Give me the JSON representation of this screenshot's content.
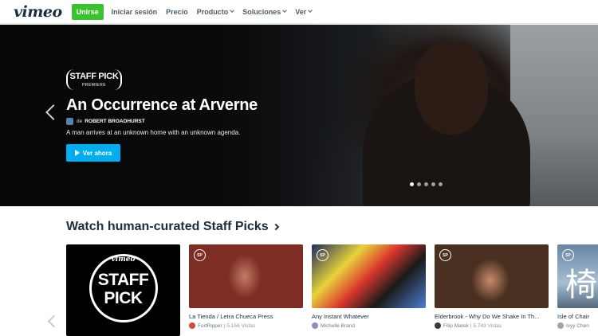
{
  "nav": {
    "logo": "vimeo",
    "join": "Unirse",
    "login": "Iniciar sesión",
    "price": "Precio",
    "product": "Producto",
    "solutions": "Soluciones",
    "watch": "Ver"
  },
  "hero": {
    "badge_main": "STAFF PICK",
    "badge_sub": "PREMIERE",
    "title": "An Occurrence at Arverne",
    "by": "de",
    "author": "ROBERT BROADHURST",
    "description": "A man arrives at an unknown home with an unknown agenda.",
    "watch_button": "Ver ahora",
    "slide_count": 5,
    "active_slide": 1
  },
  "section": {
    "title": "Watch human-curated Staff Picks"
  },
  "staff_pick_card": {
    "brand": "vimeo",
    "line1": "STAFF",
    "line2": "PICK"
  },
  "videos": [
    {
      "tag": "SP",
      "title": "La Tienda / Letra Chueca Press",
      "author": "FortRipper",
      "views": "5.156 Vistas",
      "avatar_color": "#d24a3a"
    },
    {
      "tag": "SP",
      "title": "Any Instant Whatever",
      "author": "Michelle Brand",
      "views": "",
      "avatar_color": "#8a8fc0"
    },
    {
      "tag": "SP",
      "title": "Elderbrook - Why Do We Shake In Th...",
      "author": "Filip Marek",
      "views": "5.743 Vistas",
      "avatar_color": "#333a40"
    },
    {
      "tag": "SP",
      "title": "Isle of Chair",
      "author": "Ivyy Chen",
      "views": "",
      "avatar_color": "#9aa4ac",
      "glyph": "椅"
    }
  ]
}
